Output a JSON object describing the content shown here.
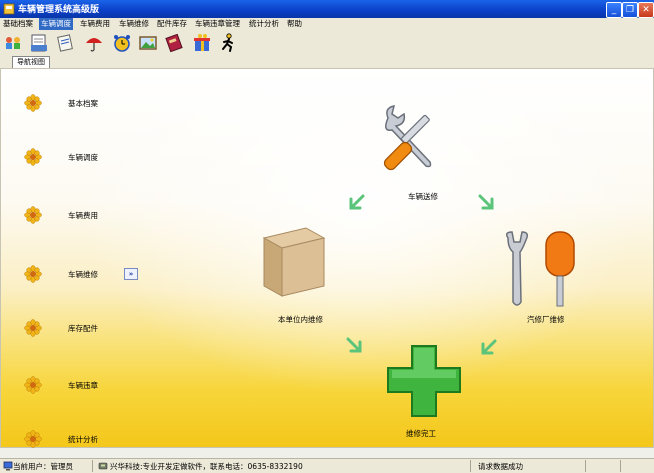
{
  "window": {
    "title": "车辆管理系统高级版",
    "controls": {
      "minimize": "_",
      "maximize": "❐",
      "close": "✕"
    }
  },
  "menu": [
    {
      "label": "基础档案"
    },
    {
      "label": "车辆调度",
      "active": true
    },
    {
      "label": "车辆费用"
    },
    {
      "label": "车辆维修"
    },
    {
      "label": "配件库存"
    },
    {
      "label": "车辆违章管理"
    },
    {
      "label": "统计分析"
    },
    {
      "label": "帮助"
    }
  ],
  "toolbar_icons": [
    "people-icon",
    "document-icon",
    "notes-icon",
    "umbrella-icon",
    "alarm-clock-icon",
    "picture-icon",
    "book-icon",
    "gift-icon",
    "running-man-icon"
  ],
  "tabs": {
    "navigation": "导航视图"
  },
  "sidebar": {
    "items": [
      {
        "label": "基本档案"
      },
      {
        "label": "车辆调度"
      },
      {
        "label": "车辆费用"
      },
      {
        "label": "车辆维修"
      },
      {
        "label": "库存配件"
      },
      {
        "label": "车辆违章"
      },
      {
        "label": "统计分析"
      }
    ],
    "collapse": "»"
  },
  "flow": {
    "send_repair": "车辆送修",
    "internal_repair": "本单位内维修",
    "external_repair": "汽修厂维修",
    "repair_done": "维修完工"
  },
  "status": {
    "user": "当前用户：管理员",
    "company": "兴华科技:专业开发定做软件，联系电话：0635-8332190",
    "message": "请求数据成功"
  },
  "colors": {
    "accent": "#316ac5",
    "titlebar": "#0a3fc7"
  }
}
